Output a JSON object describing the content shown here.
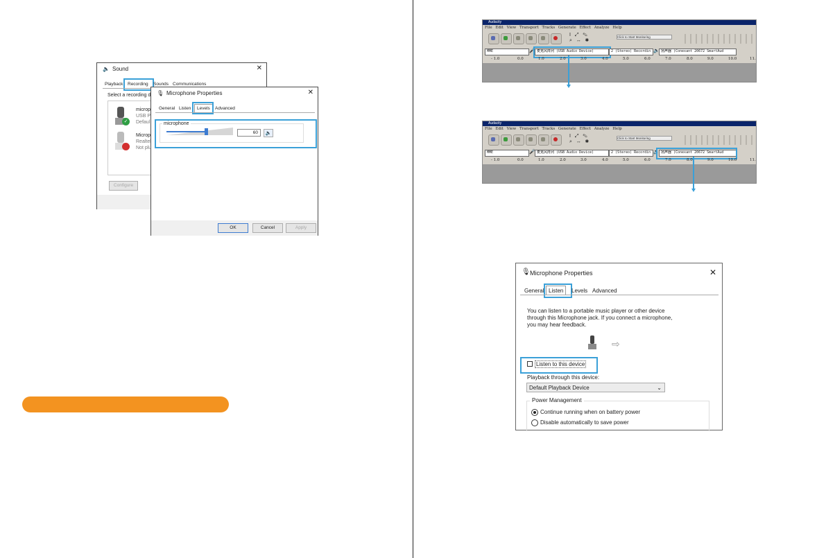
{
  "sound_dialog": {
    "title": "Sound",
    "tabs": [
      "Playback",
      "Recording",
      "Sounds",
      "Communications"
    ],
    "instruction": "Select a recording de",
    "devices": [
      {
        "name": "microp",
        "line1": "USB Pr",
        "line2": "Defaul"
      },
      {
        "name": "Microp",
        "line1": "Realtek",
        "line2": "Not plu"
      }
    ],
    "configure_label": "Configure"
  },
  "mic_props_small": {
    "title": "Microphone Properties",
    "tabs": [
      "General",
      "Listen",
      "Levels",
      "Advanced"
    ],
    "group_label": "microphone",
    "level_value": "60",
    "level_fraction": 0.6,
    "ok_label": "OK",
    "cancel_label": "Cancel",
    "apply_label": "Apply"
  },
  "audacity": {
    "title": "Audacity",
    "menu": [
      "File",
      "Edit",
      "View",
      "Transport",
      "Tracks",
      "Generate",
      "Effect",
      "Analyze",
      "Help"
    ],
    "monitor_label": "Click to Start Monitoring",
    "host": "MME",
    "input_device": "麦克风阵列 (USB Audio Device)",
    "channels": "2 (Stereo) Recordin",
    "output_device": "扬声器 (Conexant 20672 SmartAud",
    "ruler": [
      "- 1.0",
      "0.0",
      "1.0",
      "2.0",
      "3.0",
      "4.0",
      "5.0",
      "6.0",
      "7.0",
      "8.0",
      "9.0",
      "10.0",
      "11."
    ]
  },
  "mic_props_listen": {
    "title": "Microphone Properties",
    "tabs": [
      "General",
      "Listen",
      "Levels",
      "Advanced"
    ],
    "description": "You can listen to a portable music player or other device through this Microphone jack.  If you connect a microphone, you may hear feedback.",
    "listen_checkbox": "Listen to this device",
    "playback_label": "Playback through this device:",
    "playback_device": "Default Playback Device",
    "power_group": "Power Management",
    "radio1": "Continue running when on battery power",
    "radio2": "Disable automatically to save power"
  },
  "colors": {
    "highlight": "#3aa0d8",
    "orange": "#f39320"
  }
}
